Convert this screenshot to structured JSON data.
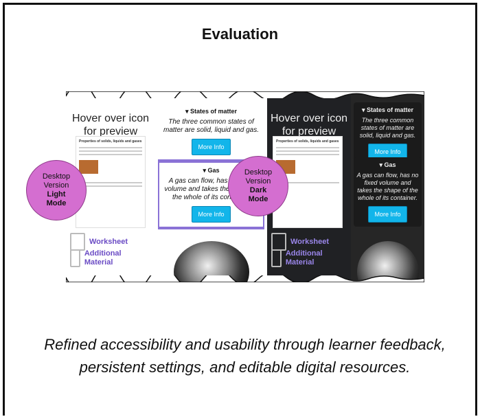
{
  "title": "Evaluation",
  "light": {
    "hover_title": "Hover over icon for preview",
    "worksheet_heading": "Properties of solids, liquids and gases",
    "resources": [
      "Worksheet",
      "Additional Material"
    ],
    "cards": [
      {
        "heading": "▾ States of matter",
        "text": "The three common states of matter are solid, liquid and gas.",
        "button": "More Info"
      },
      {
        "heading": "▾ Gas",
        "text": "A gas can flow, has no fixed volume and takes the shape of the whole of its container.",
        "button": "More Info"
      }
    ]
  },
  "dark": {
    "hover_title": "Hover over icon for preview",
    "worksheet_heading": "Properties of solids, liquids and gases",
    "resources": [
      "Worksheet",
      "Additional Material"
    ],
    "cards": [
      {
        "heading": "▾ States of matter",
        "text": "The three common states of matter are solid, liquid and gas.",
        "button": "More Info"
      },
      {
        "heading": "▾ Gas",
        "text": "A gas can flow, has no fixed volume and takes the shape of the whole of its container.",
        "button": "More Info"
      }
    ]
  },
  "bubbles": [
    {
      "line1": "Desktop",
      "line2": "Version",
      "line3": "Light",
      "line4": "Mode"
    },
    {
      "line1": "Desktop",
      "line2": "Version",
      "line3": "Dark",
      "line4": "Mode"
    }
  ],
  "caption": "Refined accessibility and usability through learner feedback, persistent settings, and editable digital resources.",
  "colors": {
    "accent": "#8a72d6",
    "button": "#12b5ea",
    "bubble": "#d46ed0"
  }
}
